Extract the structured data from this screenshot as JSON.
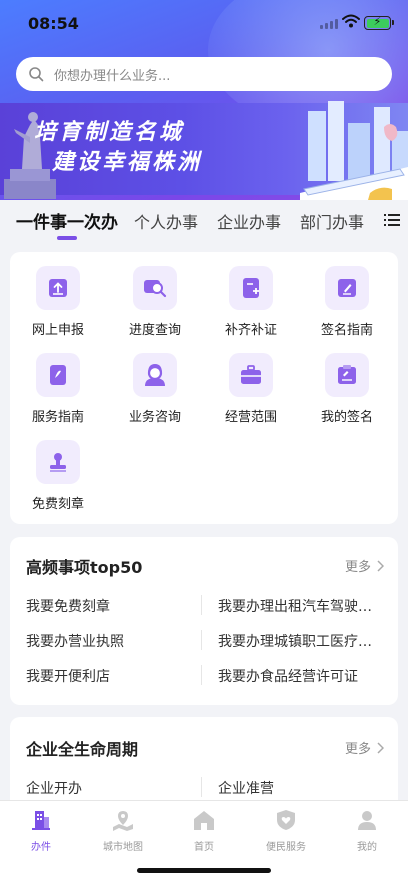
{
  "status_bar": {
    "time": "08:54"
  },
  "search": {
    "placeholder": "你想办理什么业务..."
  },
  "banner": {
    "line1": "培育制造名城",
    "line2": "建设幸福株洲"
  },
  "tabs": [
    {
      "label": "一件事一次办",
      "active": true
    },
    {
      "label": "个人办事",
      "active": false
    },
    {
      "label": "企业办事",
      "active": false
    },
    {
      "label": "部门办事",
      "active": false
    }
  ],
  "services": [
    {
      "label": "网上申报",
      "icon": "upload-icon"
    },
    {
      "label": "进度查询",
      "icon": "search-progress-icon"
    },
    {
      "label": "补齐补证",
      "icon": "add-document-icon"
    },
    {
      "label": "签名指南",
      "icon": "sign-pen-icon"
    },
    {
      "label": "服务指南",
      "icon": "guide-book-icon"
    },
    {
      "label": "业务咨询",
      "icon": "consultant-icon"
    },
    {
      "label": "经营范围",
      "icon": "briefcase-icon"
    },
    {
      "label": "我的签名",
      "icon": "my-signature-icon"
    },
    {
      "label": "免费刻章",
      "icon": "stamp-icon"
    }
  ],
  "top50": {
    "title": "高频事项top50",
    "more": "更多",
    "items": [
      "我要免费刻章",
      "我要办理出租汽车驾驶员从业资格证",
      "我要办营业执照",
      "我要办理城镇职工医疗保险",
      "我要开便利店",
      "我要办食品经营许可证"
    ]
  },
  "lifecycle": {
    "title": "企业全生命周期",
    "more": "更多",
    "items": [
      "企业开办",
      "企业准营"
    ]
  },
  "bottom_nav": [
    {
      "label": "办件",
      "icon": "building-icon",
      "active": true
    },
    {
      "label": "城市地图",
      "icon": "map-icon",
      "active": false
    },
    {
      "label": "首页",
      "icon": "home-icon",
      "active": false
    },
    {
      "label": "便民服务",
      "icon": "shield-heart-icon",
      "active": false
    },
    {
      "label": "我的",
      "icon": "profile-icon",
      "active": false
    }
  ],
  "colors": {
    "accent": "#7b4fe6",
    "icon_bg": "#f1ecfd",
    "page_bg": "#f2f3f7"
  }
}
